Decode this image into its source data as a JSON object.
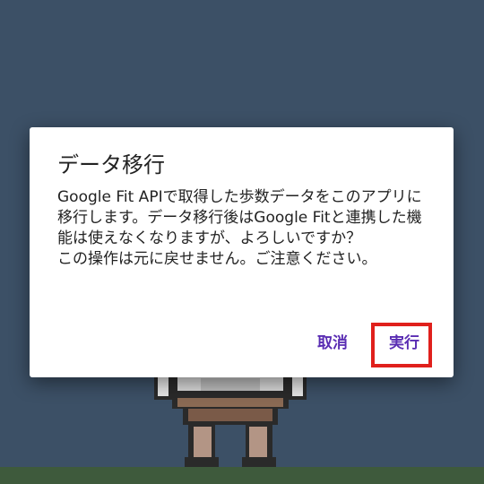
{
  "dialog": {
    "title": "データ移行",
    "message": "Google Fit APIで取得した歩数データをこのアプリに移行します。データ移行後はGoogle Fitと連携した機能は使えなくなりますが、よろしいですか？\nこの操作は元に戻せません。ご注意ください。",
    "cancel_label": "取消",
    "execute_label": "実行"
  },
  "colors": {
    "background": "#3c5066",
    "dialog_bg": "#ffffff",
    "button_text": "#5a2db3",
    "highlight": "#e0201c",
    "ground": "#3e5a3c"
  },
  "icons": {
    "character": "pixel-character-icon"
  }
}
